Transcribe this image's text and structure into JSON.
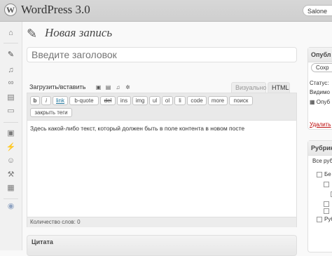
{
  "header": {
    "logo_letter": "W",
    "site_title": "WordPress 3.0",
    "howdy_button": "Salone"
  },
  "admin_menu": {
    "icons": [
      "dashboard-icon",
      "posts-icon",
      "media-icon",
      "links-icon",
      "pages-icon",
      "comments-icon",
      "appearance-icon",
      "plugins-icon",
      "users-icon",
      "tools-icon",
      "settings-icon",
      "collapse-icon"
    ]
  },
  "page": {
    "title": "Новая запись",
    "title_placeholder": "Введите заголовок"
  },
  "editor": {
    "upload_label": "Загрузить/вставить",
    "tab_visual": "Визуально",
    "tab_html": "HTML",
    "quicktags": [
      "b",
      "i",
      "link",
      "b-quote",
      "del",
      "ins",
      "img",
      "ul",
      "ol",
      "li",
      "code",
      "more",
      "поиск",
      "закрыть теги"
    ],
    "content": "Здесь какой-либо текст, который должен быть в поле контента в новом посте",
    "word_count": "Количество слов: 0"
  },
  "excerpt": {
    "title": "Цитата"
  },
  "publish": {
    "title": "Опубл",
    "save_button": "Сохр",
    "status": "Статус:",
    "visibility": "Видимо",
    "publish_label": "Опуб",
    "trash_link": "Удалить"
  },
  "categories": {
    "title": "Рубрик",
    "tab_all": "Все руб",
    "items": [
      "Бе",
      "",
      "",
      "",
      "Руб"
    ]
  }
}
